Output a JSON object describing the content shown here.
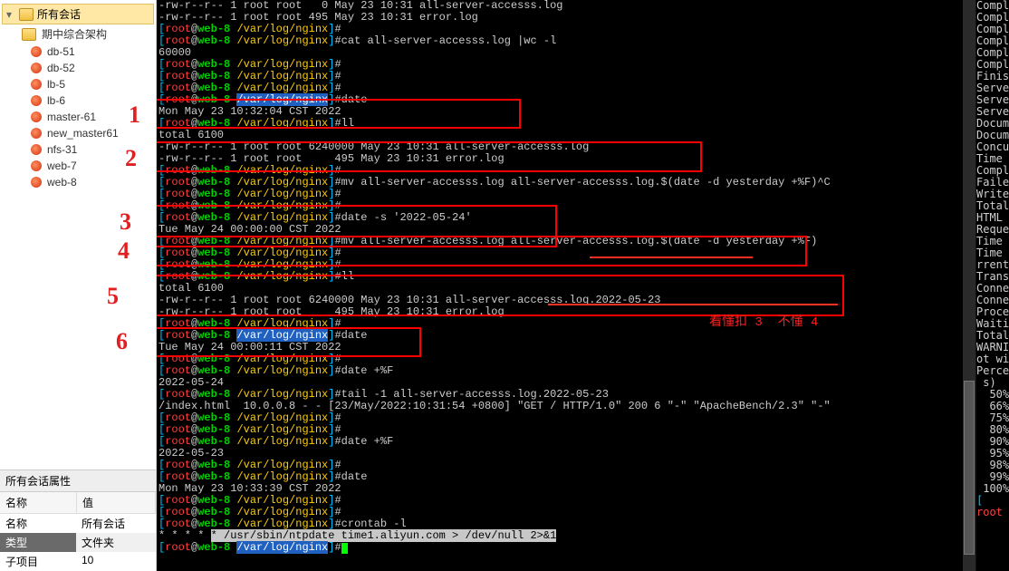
{
  "sidebar": {
    "root_label": "所有会话",
    "folder_label": "期中综合架构",
    "items": [
      {
        "label": "db-51"
      },
      {
        "label": "db-52"
      },
      {
        "label": "lb-5"
      },
      {
        "label": "lb-6"
      },
      {
        "label": "master-61"
      },
      {
        "label": "new_master61"
      },
      {
        "label": "nfs-31"
      },
      {
        "label": "web-7"
      },
      {
        "label": "web-8"
      }
    ],
    "props_title": "所有会话属性",
    "props_header_key": "名称",
    "props_header_val": "值",
    "props_rows": [
      {
        "k": "名称",
        "v": "所有会话"
      },
      {
        "k": "类型",
        "v": "文件夹"
      },
      {
        "k": "子项目",
        "v": "10"
      }
    ]
  },
  "prompt": {
    "open": "[",
    "user": "root",
    "at": "@",
    "host": "web-8",
    "space": " ",
    "path": "/var/log/nginx",
    "close": "]",
    "hash": "#"
  },
  "term": {
    "l0": "-rw-r--r-- 1 root root   0 May 23 10:31 all-server-accesss.log",
    "l1": "-rw-r--r-- 1 root root 495 May 23 10:31 error.log",
    "cat": "cat all-server-accesss.log |wc -l",
    "catout": "60000",
    "date1": "date",
    "date1out": "Mon May 23 10:32:04 CST 2022",
    "ll": "ll",
    "total": "total 6100",
    "ll1": "-rw-r--r-- 1 root root 6240000 May 23 10:31 all-server-accesss.log",
    "ll2": "-rw-r--r-- 1 root root     495 May 23 10:31 error.log",
    "mv_abort": "mv all-server-accesss.log all-server-accesss.log.$(date -d yesterday +%F)^C",
    "dateset": "date -s '2022-05-24'",
    "datesetout": "Tue May 24 00:00:00 CST 2022",
    "mv2": "mv all-server-accesss.log all-server-accesss.log.$(date -d yesterday +%F)",
    "ll3": "ll",
    "total2": "total 6100",
    "ll3a": "-rw-r--r-- 1 root root 6240000 May 23 10:31 all-server-accesss.log.2022-05-23",
    "ll3b": "-rw-r--r-- 1 root root     495 May 23 10:31 error.log",
    "date2": "date",
    "date2out": "Tue May 24 00:00:11 CST 2022",
    "dateF": "date +%F",
    "dateFout": "2022-05-24",
    "tail": "tail -1 all-server-accesss.log.2022-05-23",
    "tailout": "/index.html  10.0.0.8 - - [23/May/2022:10:31:54 +0800] \"GET / HTTP/1.0\" 200 6 \"-\" \"ApacheBench/2.3\" \"-\"",
    "dateF2": "date +%F",
    "dateF2out": "2022-05-23",
    "date3": "date",
    "date3out": "Mon May 23 10:33:39 CST 2022",
    "cron": "crontab -l",
    "cronout_raw": "* * * * ",
    "cronout_sel": "* /usr/sbin/ntpdate time1.aliyun.com > /dev/null 2>&1"
  },
  "annotations": {
    "nums": [
      "1",
      "2",
      "3",
      "4",
      "5",
      "6"
    ],
    "redtext": "看懂扣 3  不懂 4"
  },
  "rightstrip": {
    "lines": [
      "Compl",
      "Compl",
      "Compl",
      "Compl",
      "Compl",
      "Compl",
      "Finis",
      "",
      "Serve",
      "Serve",
      "Serve",
      "",
      "Docum",
      "Docum",
      "",
      "Concu",
      "Time ",
      "Compl",
      "Faile",
      "Write",
      "Total",
      "HTML ",
      "Reque",
      "Time ",
      "Time ",
      "rrent",
      "Trans",
      "",
      "Conne",
      "",
      "Conne",
      "Proce",
      "Waiti",
      "Total",
      "WARNI",
      "ot wi",
      "",
      "",
      "Perce",
      " s)",
      "  50%",
      "  66%",
      "  75%",
      "  80%",
      "  90%",
      "  95%",
      "  98%",
      "  99%",
      " 100%"
    ],
    "lastline": "[root"
  }
}
